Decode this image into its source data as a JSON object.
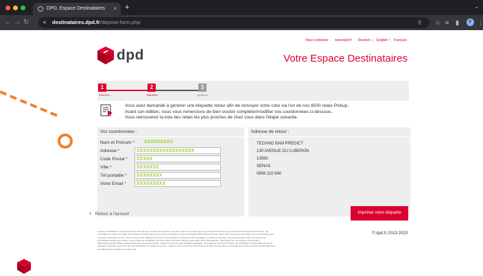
{
  "browser": {
    "tab_title": "DPD, Espace Destinataires",
    "tab_close": "×",
    "new_tab": "+",
    "url_host": "destinataires.dpd.fr",
    "url_path": "/depose-form.php",
    "profile_initial": "F"
  },
  "header": {
    "links": [
      "Nous contacter",
      "www.dpd.fr",
      "Deutsch",
      "English",
      "Français"
    ],
    "logo_text": "dpd",
    "title": "Votre Espace Destinataires"
  },
  "steps": [
    {
      "number": "1",
      "label": "Sélection",
      "state": "done"
    },
    {
      "number": "2",
      "label": "Validation",
      "state": "active"
    },
    {
      "number": "3",
      "label": "Synthèse",
      "state": "pending"
    }
  ],
  "info": {
    "lines": [
      "Vous avez demandé à générer une étiquette retour afin de renvoyer votre colis via l'un de nos 8500 relais Pickup.",
      "Avant son édition, nous vous remercions de bien vouloir compléter/modifier vos coordonnées ci-dessous.",
      "Vous retrouverez la liste des relais les plus proches de chez vous dans l'étape suivante."
    ]
  },
  "form": {
    "title": "Vos coordonnées :",
    "name": {
      "label": "Nom et Prénom",
      "value": "XXXXXXXXX"
    },
    "address": {
      "label": "Adresse",
      "value": "XXXXXXXXXXXXXXXXXX"
    },
    "postal": {
      "label": "Code Postal",
      "value": "XXXXX"
    },
    "city": {
      "label": "Ville",
      "value": "XXXXXXX"
    },
    "mobile": {
      "label": "Tél portable",
      "value": "XXXXXXXX"
    },
    "email": {
      "label": "Votre Email",
      "value": "XXXXXXXXX"
    },
    "required_mark": "*"
  },
  "return_address": {
    "title": "Adresse de retour :",
    "lines": [
      "TECHNO BAM PREDICT",
      "130 AVENUE DU LUBERON",
      "13560",
      "SENAS",
      "0806 110 640"
    ]
  },
  "actions": {
    "back": "Retour à l'accueil",
    "print": "Imprimer votre étiquette"
  },
  "footer": {
    "copyright": "© dpd.fr 2013-2023",
    "legal": "L'espace destinataires vous permet d'être informé de la situation de la livraison de votre colis. Vos coordonnées nous ont été transmises, pour les besoins exclusifs de la livraison, par l'expéditeur de votre colis. Elles sont destinées à DPD France ainsi qu'aux prestataires externes auxquels DPD France fait appel. Elles seront conservées pendant 1 an puis archivées pour une durée maximale de 3 ans. Elles ne seront pas utilisées à des fins de prospection commerciale. Afin d'améliorer nos offres et services, nous pouvons faire l'objet d'un traitement informatique destiné à la mesure et aux études de satisfaction par des instituts d'études externes situés dans l'Union Européenne. Information sur vos données personnelles : https://www.dpd.fr/politique-protection-des-donnees-personnelles. Conformément à la réglementation applicable, vous disposez d'un droit d'accès, de rectification et d'opposition et de vos données à caractère personnel. En cas d'instruction de livraison à un tiers : veillez à vous assurer de l'accord de ce dernier pour la collecte et le traitement de ses données personnelles pour la réalisation de la livraison de votre colis."
  },
  "colors": {
    "brand_red": "#dc0032",
    "field_green": "#9bd12c",
    "panel_grey": "#eeeeee",
    "deco_orange": "#f07f2c"
  }
}
